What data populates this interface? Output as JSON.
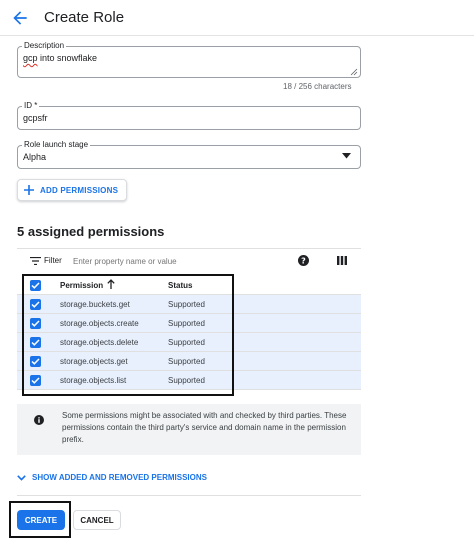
{
  "header": {
    "title": "Create Role"
  },
  "description": {
    "label": "Description",
    "value_marked": "gcp",
    "value_rest": " into snowflake",
    "char_count": "18 / 256 characters"
  },
  "id_field": {
    "label": "ID *",
    "value": "gcpsfr"
  },
  "launch_stage": {
    "label": "Role launch stage",
    "selected": "Alpha"
  },
  "add_permissions": {
    "label": "ADD PERMISSIONS"
  },
  "assigned": {
    "title": "5 assigned permissions",
    "filter_label": "Filter",
    "filter_placeholder": "Enter property name or value",
    "columns": {
      "permission": "Permission",
      "status": "Status"
    },
    "rows": [
      {
        "permission": "storage.buckets.get",
        "status": "Supported"
      },
      {
        "permission": "storage.objects.create",
        "status": "Supported"
      },
      {
        "permission": "storage.objects.delete",
        "status": "Supported"
      },
      {
        "permission": "storage.objects.get",
        "status": "Supported"
      },
      {
        "permission": "storage.objects.list",
        "status": "Supported"
      }
    ]
  },
  "info": {
    "text": "Some permissions might be associated with and checked by third parties. These permissions contain the third party's service and domain name in the permission prefix."
  },
  "show_changes": {
    "label": "SHOW ADDED AND REMOVED PERMISSIONS"
  },
  "actions": {
    "create": "CREATE",
    "cancel": "CANCEL"
  },
  "colors": {
    "accent": "#1a73e8",
    "selected_row": "#e8f0fe",
    "info_bg": "#f1f3f4"
  }
}
